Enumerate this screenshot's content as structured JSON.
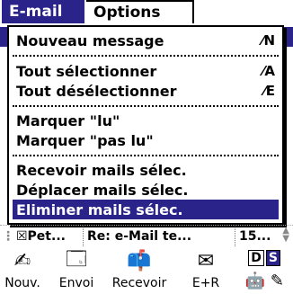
{
  "menubar": {
    "email": "E-mail",
    "options": "Options"
  },
  "menu": {
    "items": [
      {
        "label": "Nouveau message",
        "shortcut": "⁄N"
      },
      {
        "label": "Tout sélectionner",
        "shortcut": "⁄A"
      },
      {
        "label": "Tout désélectionner",
        "shortcut": "⁄E"
      },
      {
        "label": "Marquer \"lu\"",
        "shortcut": ""
      },
      {
        "label": "Marquer \"pas lu\"",
        "shortcut": ""
      },
      {
        "label": "Recevoir mails sélec.",
        "shortcut": ""
      },
      {
        "label": "Déplacer mails sélec.",
        "shortcut": ""
      },
      {
        "label": "Eliminer mails  sélec.",
        "shortcut": ""
      }
    ],
    "selected": "Eliminer mails  sélec."
  },
  "background_row": {
    "cell1": "☒Pet...",
    "cell2": "Re: e-Mail te...",
    "cell3": "15..."
  },
  "toolbar": {
    "nouv": "Nouv.",
    "envoi": "Envoi",
    "recevoir": "Recevoir",
    "er": "E+R",
    "d": "D",
    "s": "S"
  },
  "colors": {
    "accent": "#2a248a"
  }
}
